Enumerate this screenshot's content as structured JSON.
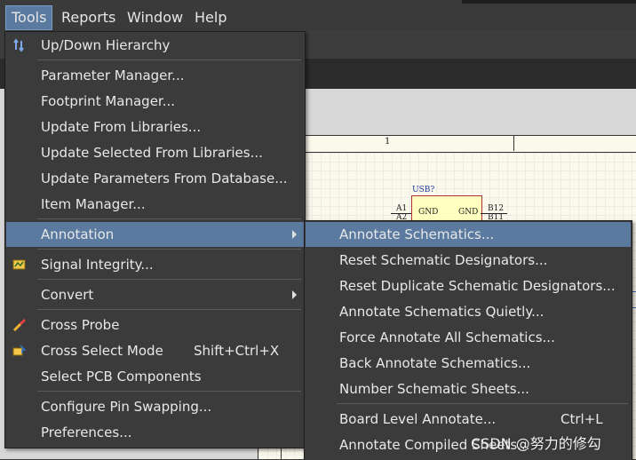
{
  "menubar": {
    "items": [
      {
        "label": "Tools"
      },
      {
        "label": "Reports"
      },
      {
        "label": "Window"
      },
      {
        "label": "Help"
      }
    ]
  },
  "schematic": {
    "sheet_column_label": "1",
    "designator": "USB?",
    "pins": {
      "a1": "A1",
      "a2": "A2",
      "b12": "B12",
      "b11": "B11",
      "gnd_left": "GND",
      "gnd_right": "GND"
    }
  },
  "tools_menu": {
    "items": [
      {
        "label": "Up/Down Hierarchy",
        "icon": "hierarchy-arrows-icon"
      },
      {
        "label": "Parameter Manager..."
      },
      {
        "label": "Footprint Manager..."
      },
      {
        "label": "Update From Libraries..."
      },
      {
        "label": "Update Selected From Libraries..."
      },
      {
        "label": "Update Parameters From Database..."
      },
      {
        "label": "Item Manager..."
      },
      {
        "label": "Annotation",
        "submenu": true
      },
      {
        "label": "Signal Integrity...",
        "icon": "signal-integrity-icon"
      },
      {
        "label": "Convert",
        "submenu": true
      },
      {
        "label": "Cross Probe",
        "icon": "cross-probe-icon"
      },
      {
        "label": "Cross Select Mode",
        "shortcut": "Shift+Ctrl+X",
        "icon": "cross-select-icon"
      },
      {
        "label": "Select PCB Components"
      },
      {
        "label": "Configure Pin Swapping..."
      },
      {
        "label": "Preferences..."
      }
    ]
  },
  "annotation_submenu": {
    "items": [
      {
        "label": "Annotate Schematics..."
      },
      {
        "label": "Reset Schematic Designators..."
      },
      {
        "label": "Reset Duplicate Schematic Designators..."
      },
      {
        "label": "Annotate Schematics Quietly..."
      },
      {
        "label": "Force Annotate All Schematics..."
      },
      {
        "label": "Back Annotate Schematics..."
      },
      {
        "label": "Number Schematic Sheets..."
      },
      {
        "label": "Board Level Annotate...",
        "shortcut": "Ctrl+L"
      },
      {
        "label": "Annotate Compiled Sheets..."
      }
    ]
  },
  "watermark": "CSDN @努力的修勾",
  "colors": {
    "highlight": "#5a7aa0",
    "menu_bg": "#3b3b3b"
  }
}
